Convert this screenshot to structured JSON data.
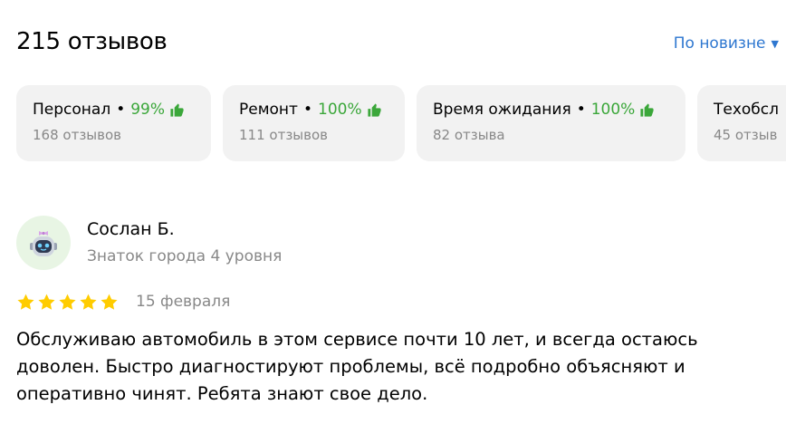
{
  "header": {
    "title": "215 отзывов",
    "sort_label": "По новизне"
  },
  "chips": [
    {
      "name": "Персонал",
      "percent": "99%",
      "count": "168 отзывов"
    },
    {
      "name": "Ремонт",
      "percent": "100%",
      "count": "111 отзывов"
    },
    {
      "name": "Время ожидания",
      "percent": "100%",
      "count": "82 отзыва"
    },
    {
      "name": "Техобсл",
      "percent": "",
      "count": "45 отзыв"
    }
  ],
  "review": {
    "author_name": "Сослан Б.",
    "author_level": "Знаток города 4 уровня",
    "rating": 5,
    "date": "15 февраля",
    "text": "Обслуживаю автомобиль в этом сервисе почти 10 лет, и всегда остаюсь доволен. Быстро диагностируют проблемы, всё подробно объясняют и оперативно чинят. Ребята знают свое дело."
  },
  "colors": {
    "accent_link": "#2e77d0",
    "positive": "#3ba73a",
    "star": "#fc0",
    "chip_bg": "#f2f2f2",
    "muted_text": "#888888",
    "avatar_bg": "#e8f5e4"
  },
  "icons": {
    "thumb": "thumbs-up-icon",
    "star": "star-icon",
    "caret": "caret-down-icon",
    "avatar": "robot-avatar-icon"
  }
}
